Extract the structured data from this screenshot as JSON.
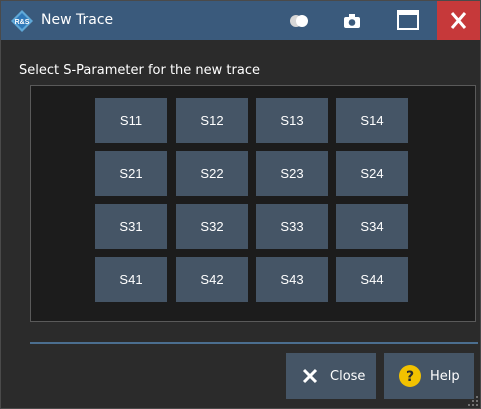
{
  "window": {
    "title": "New Trace",
    "icons": [
      "rs-logo-icon",
      "toggle-icon",
      "camera-icon",
      "maximize-icon",
      "close-icon"
    ],
    "colors": {
      "titlebar": "#3a5a7c",
      "close": "#c6393a",
      "button": "#455566",
      "panel": "#1c1c1c",
      "body": "#2b2b2b",
      "help_icon": "#f2c200"
    }
  },
  "prompt": "Select S-Parameter for the new trace",
  "sparams": [
    [
      "S11",
      "S12",
      "S13",
      "S14"
    ],
    [
      "S21",
      "S22",
      "S23",
      "S24"
    ],
    [
      "S31",
      "S32",
      "S33",
      "S34"
    ],
    [
      "S41",
      "S42",
      "S43",
      "S44"
    ]
  ],
  "footer": {
    "close_label": "Close",
    "help_label": "Help"
  }
}
